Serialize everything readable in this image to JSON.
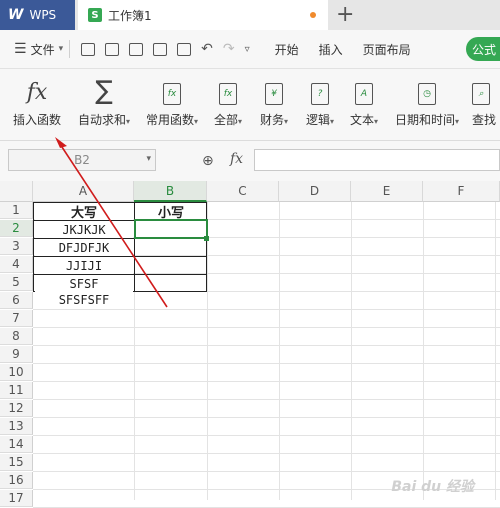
{
  "titlebar": {
    "app_label": "WPS",
    "doc_tab_label": "工作簿1",
    "new_tab_symbol": "+"
  },
  "menubar": {
    "file_label": "文件",
    "items": [
      "开始",
      "插入",
      "页面布局"
    ],
    "active_tab_label": "公式"
  },
  "ribbon": {
    "buttons": [
      {
        "label": "插入函数",
        "icon": "fx-icon"
      },
      {
        "label": "自动求和",
        "icon": "sigma-icon",
        "dropdown": true
      },
      {
        "label": "常用函数",
        "icon": "common-function-icon",
        "dropdown": true
      },
      {
        "label": "全部",
        "icon": "all-functions-icon",
        "dropdown": true
      },
      {
        "label": "财务",
        "icon": "finance-icon",
        "dropdown": true
      },
      {
        "label": "逻辑",
        "icon": "logic-icon",
        "dropdown": true
      },
      {
        "label": "文本",
        "icon": "text-icon",
        "dropdown": true
      },
      {
        "label": "日期和时间",
        "icon": "datetime-icon",
        "dropdown": true
      },
      {
        "label": "查找",
        "icon": "lookup-icon"
      }
    ]
  },
  "formula_bar": {
    "name_box": "B2",
    "fx_symbol": "fx",
    "formula_value": ""
  },
  "sheet": {
    "columns": [
      "A",
      "B",
      "C",
      "D",
      "E",
      "F"
    ],
    "rows": [
      "1",
      "2",
      "3",
      "4",
      "5",
      "6",
      "7",
      "8",
      "9",
      "10",
      "11",
      "12",
      "13",
      "14",
      "15",
      "16",
      "17"
    ],
    "selected_column": "B",
    "selected_row": "2",
    "cells": {
      "A1": "大写",
      "B1": "小写",
      "A2": "JKJKJK",
      "A3": "DFJDFJK",
      "A4": "JJIJI",
      "A5": "SFSF",
      "A6": "SFSFSFF"
    }
  },
  "colors": {
    "brand_blue": "#3b5998",
    "accent_green": "#2a8c3f",
    "annotation_red": "#d01c1c"
  }
}
